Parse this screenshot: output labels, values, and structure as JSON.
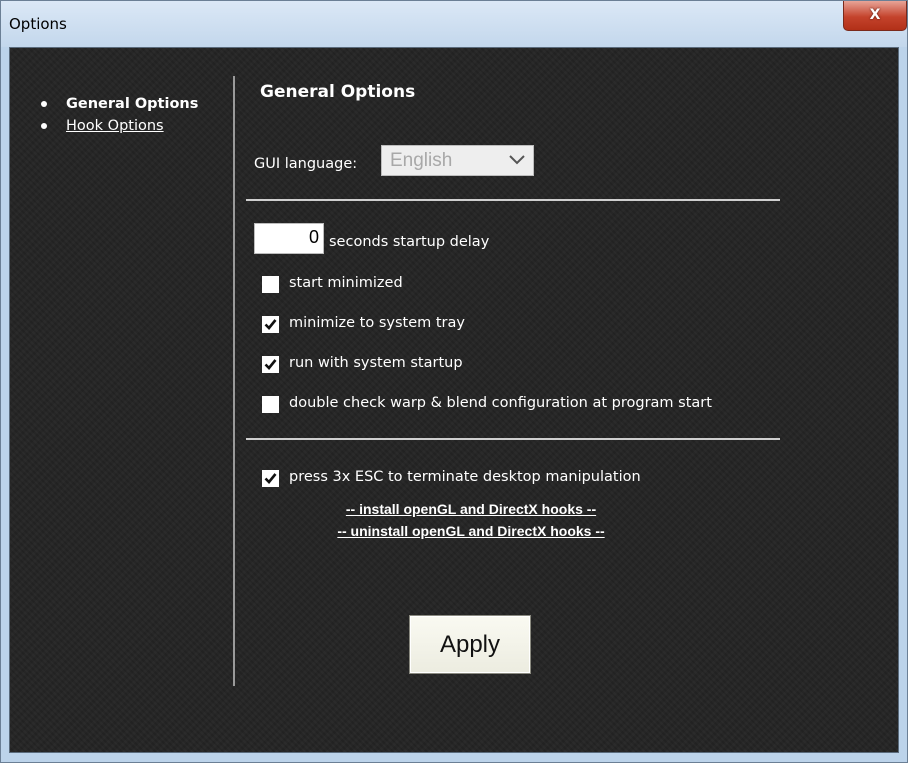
{
  "window": {
    "title": "Options",
    "close_label": "X"
  },
  "nav": [
    {
      "label": "General Options",
      "active": true
    },
    {
      "label": "Hook Options",
      "active": false
    }
  ],
  "section": {
    "title": "General Options"
  },
  "language": {
    "label": "GUI language:",
    "value": "English"
  },
  "startup_delay": {
    "value": "0",
    "label": "seconds startup delay"
  },
  "options": [
    {
      "label": "start minimized",
      "checked": false
    },
    {
      "label": "minimize to system tray",
      "checked": true
    },
    {
      "label": "run with system startup",
      "checked": true
    },
    {
      "label": "double check warp & blend configuration at program start",
      "checked": false
    }
  ],
  "esc_option": {
    "label": "press 3x ESC to terminate desktop manipulation",
    "checked": true
  },
  "hooks": {
    "install_label": "-- install openGL and DirectX hooks --",
    "uninstall_label": "-- uninstall openGL and DirectX hooks --"
  },
  "apply_label": "Apply"
}
